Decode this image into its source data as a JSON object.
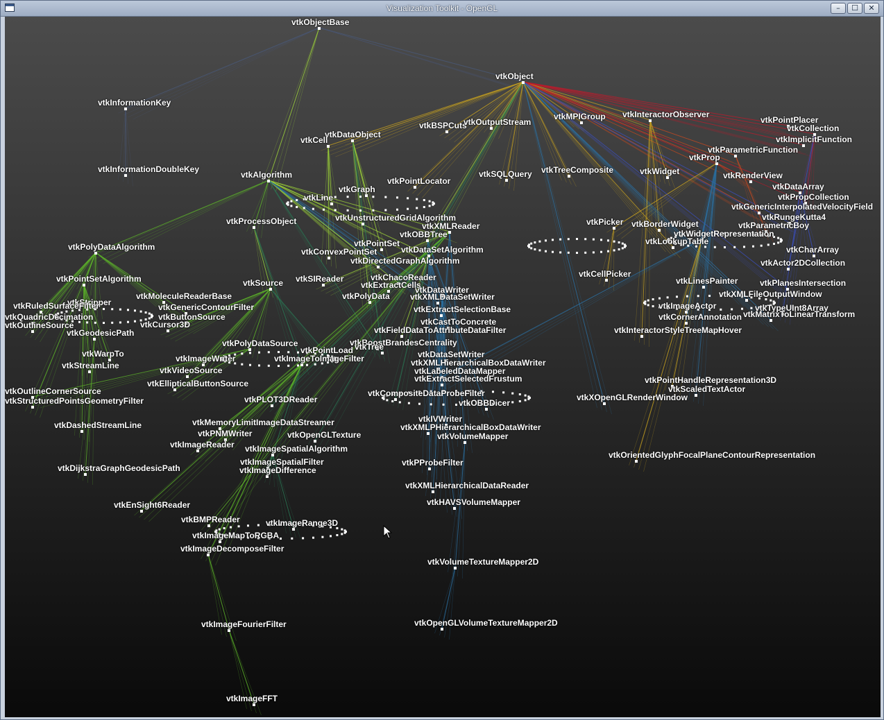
{
  "window": {
    "title": "Visualization Toolkit - OpenGL",
    "controls": {
      "minimize": "–",
      "maximize": "☐",
      "close": "✕"
    }
  },
  "colors": {
    "background_top": "#4b4b4b",
    "background_bottom": "#0a0a0a",
    "label": "#ffffff",
    "edge_palette": [
      "#c9a31f",
      "#5fb82a",
      "#2a7a55",
      "#2c6fa0",
      "#3b4fbf",
      "#d04a1e",
      "#c2192b",
      "#9fd43a"
    ]
  },
  "cursor_icon": "arrow-cursor-icon",
  "graph": {
    "nodes": [
      {
        "label": "vtkObjectBase"
      },
      {
        "label": "vtkObject"
      },
      {
        "label": "vtkInformationKey"
      },
      {
        "label": "vtkInformationDoubleKey"
      },
      {
        "label": "vtkDataObject"
      },
      {
        "label": "vtkCell"
      },
      {
        "label": "vtkBSPCuts"
      },
      {
        "label": "vtkOutputStream"
      },
      {
        "label": "vtkMPIGroup"
      },
      {
        "label": "vtkInteractorObserver"
      },
      {
        "label": "vtkPointPlacer"
      },
      {
        "label": "vtkCollection"
      },
      {
        "label": "vtkImplicitFunction"
      },
      {
        "label": "vtkParametricFunction"
      },
      {
        "label": "vtkProp"
      },
      {
        "label": "vtkAlgorithm"
      },
      {
        "label": "vtkGraph"
      },
      {
        "label": "vtkPointLocator"
      },
      {
        "label": "vtkSQLQuery"
      },
      {
        "label": "vtkTreeComposite"
      },
      {
        "label": "vtkWidget"
      },
      {
        "label": "vtkRenderView"
      },
      {
        "label": "vtkDataArray"
      },
      {
        "label": "vtkPropCollection"
      },
      {
        "label": "vtkGenericInterpolatedVelocityField"
      },
      {
        "label": "vtkRungeKutta4"
      },
      {
        "label": "vtkParametricBoy"
      },
      {
        "label": "vtkLine"
      },
      {
        "label": "vtkProcessObject"
      },
      {
        "label": "vtkUnstructuredGridAlgorithm"
      },
      {
        "label": "vtkXMLReader"
      },
      {
        "label": "vtkOBBTree"
      },
      {
        "label": "vtkPicker"
      },
      {
        "label": "vtkBorderWidget"
      },
      {
        "label": "vtkWidgetRepresentation"
      },
      {
        "label": "vtkLookupTable"
      },
      {
        "label": "vtkPolyDataAlgorithm"
      },
      {
        "label": "vtkPointSet"
      },
      {
        "label": "vtkConvexPointSet"
      },
      {
        "label": "vtkDataSetAlgorithm"
      },
      {
        "label": "vtkDirectedGraphAlgorithm"
      },
      {
        "label": "vtkCharArray"
      },
      {
        "label": "vtkActor2DCollection"
      },
      {
        "label": "vtkPointSetAlgorithm"
      },
      {
        "label": "vtkSource"
      },
      {
        "label": "vtkSIReader"
      },
      {
        "label": "vtkChacoReader"
      },
      {
        "label": "vtkExtractCells"
      },
      {
        "label": "vtkCellPicker"
      },
      {
        "label": "vtkLinesPainter"
      },
      {
        "label": "vtkPlanesIntersection"
      },
      {
        "label": "vtkMoleculeReaderBase"
      },
      {
        "label": "vtkStripper"
      },
      {
        "label": "vtkDataWriter"
      },
      {
        "label": "vtkXMLDataSetWriter"
      },
      {
        "label": "vtkPolyData"
      },
      {
        "label": "vtkXMLFileOutputWindow"
      },
      {
        "label": "vtkGenericContourFilter"
      },
      {
        "label": "vtkRuledSurfaceFilter"
      },
      {
        "label": "vtkExtractSelectionBase"
      },
      {
        "label": "vtkImageActor"
      },
      {
        "label": "vtkTypeUInt8Array"
      },
      {
        "label": "vtkQuadricDecimation"
      },
      {
        "label": "vtkButtonSource"
      },
      {
        "label": "vtkCornerAnnotation"
      },
      {
        "label": "vtkMatrixToLinearTransform"
      },
      {
        "label": "vtkOutlineSource"
      },
      {
        "label": "vtkCursor3D"
      },
      {
        "label": "vtkCastToConcrete"
      },
      {
        "label": "vtkFieldDataToAttributeDataFilter"
      },
      {
        "label": "vtkInteractorStyleTreeMapHover"
      },
      {
        "label": "vtkGeodesicPath"
      },
      {
        "label": "vtkBoostBrandesCentrality"
      },
      {
        "label": "vtkPolyDataSource"
      },
      {
        "label": "vtkTree"
      },
      {
        "label": "vtkPointLoad"
      },
      {
        "label": "vtkWarpTo"
      },
      {
        "label": "vtkImageWriter"
      },
      {
        "label": "vtkImageToImageFilter"
      },
      {
        "label": "vtkDataSetWriter"
      },
      {
        "label": "vtkStreamLine"
      },
      {
        "label": "vtkVideoSource"
      },
      {
        "label": "vtkXMLHierarchicalBoxDataWriter"
      },
      {
        "label": "vtkLabeledDataMapper"
      },
      {
        "label": "vtkExtractSelectedFrustum"
      },
      {
        "label": "vtkEllipticalButtonSource"
      },
      {
        "label": "vtkPointHandleRepresentation3D"
      },
      {
        "label": "vtkScaledTextActor"
      },
      {
        "label": "vtkOutlineCornerSource"
      },
      {
        "label": "vtkCompositeDataProbeFilter"
      },
      {
        "label": "vtkXOpenGLRenderWindow"
      },
      {
        "label": "vtkStructuredPointsGeometryFilter"
      },
      {
        "label": "vtkPLOT3DReader"
      },
      {
        "label": "vtkOBBDicer"
      },
      {
        "label": "vtkIVWriter"
      },
      {
        "label": "vtkMemoryLimitImageDataStreamer"
      },
      {
        "label": "vtkDashedStreamLine"
      },
      {
        "label": "vtkXMLPHierarchicalBoxDataWriter"
      },
      {
        "label": "vtkPNMWriter"
      },
      {
        "label": "vtkOpenGLTexture"
      },
      {
        "label": "vtkVolumeMapper"
      },
      {
        "label": "vtkImageReader"
      },
      {
        "label": "vtkImageSpatialAlgorithm"
      },
      {
        "label": "vtkOrientedGlyphFocalPlaneContourRepresentation"
      },
      {
        "label": "vtkImageSpatialFilter"
      },
      {
        "label": "vtkPProbeFilter"
      },
      {
        "label": "vtkDijkstraGraphGeodesicPath"
      },
      {
        "label": "vtkImageDifference"
      },
      {
        "label": "vtkXMLHierarchicalDataReader"
      },
      {
        "label": "vtkEnSight6Reader"
      },
      {
        "label": "vtkHAVSVolumeMapper"
      },
      {
        "label": "vtkBMPReader"
      },
      {
        "label": "vtkImageRange3D"
      },
      {
        "label": "vtkImageMapToRGBA"
      },
      {
        "label": "vtkImageDecomposeFilter"
      },
      {
        "label": "vtkVolumeTextureMapper2D"
      },
      {
        "label": "vtkOpenGLVolumeTextureMapper2D"
      },
      {
        "label": "vtkImageFourierFilter"
      },
      {
        "label": "vtkImageFFT"
      }
    ]
  }
}
